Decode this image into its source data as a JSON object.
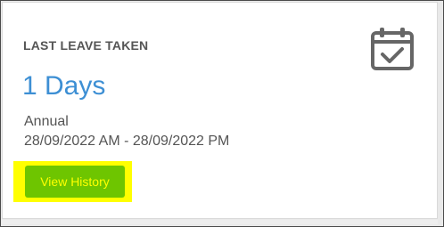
{
  "card": {
    "title": "LAST LEAVE TAKEN",
    "value": "1 Days",
    "leave_type": "Annual",
    "date_range": "28/09/2022 AM - 28/09/2022 PM",
    "icon": "calendar-check-icon",
    "button_label": "View History"
  },
  "colors": {
    "accent_blue": "#3d8fd4",
    "button_green": "#6ec500",
    "highlight_yellow": "#ffff00",
    "text_gray": "#555555"
  }
}
